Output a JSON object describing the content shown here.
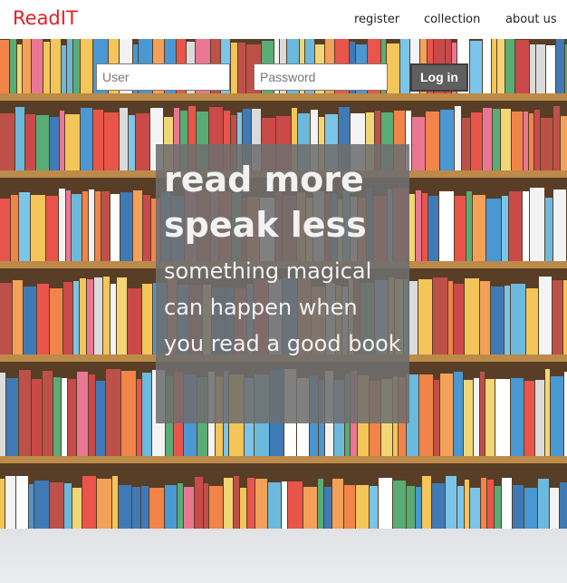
{
  "header": {
    "brand": "ReadIT",
    "nav": [
      "register",
      "collection",
      "about us"
    ]
  },
  "login": {
    "user_placeholder": "User",
    "password_placeholder": "Password",
    "button_label": "Log in"
  },
  "hero": {
    "headline_line1": "read more",
    "headline_line2": "speak less",
    "tagline": "something magical can happen when you read a good book"
  },
  "colors": {
    "brand": "#e21f26",
    "quote_box": "#6e6e6e",
    "button": "#5f5f5f"
  }
}
